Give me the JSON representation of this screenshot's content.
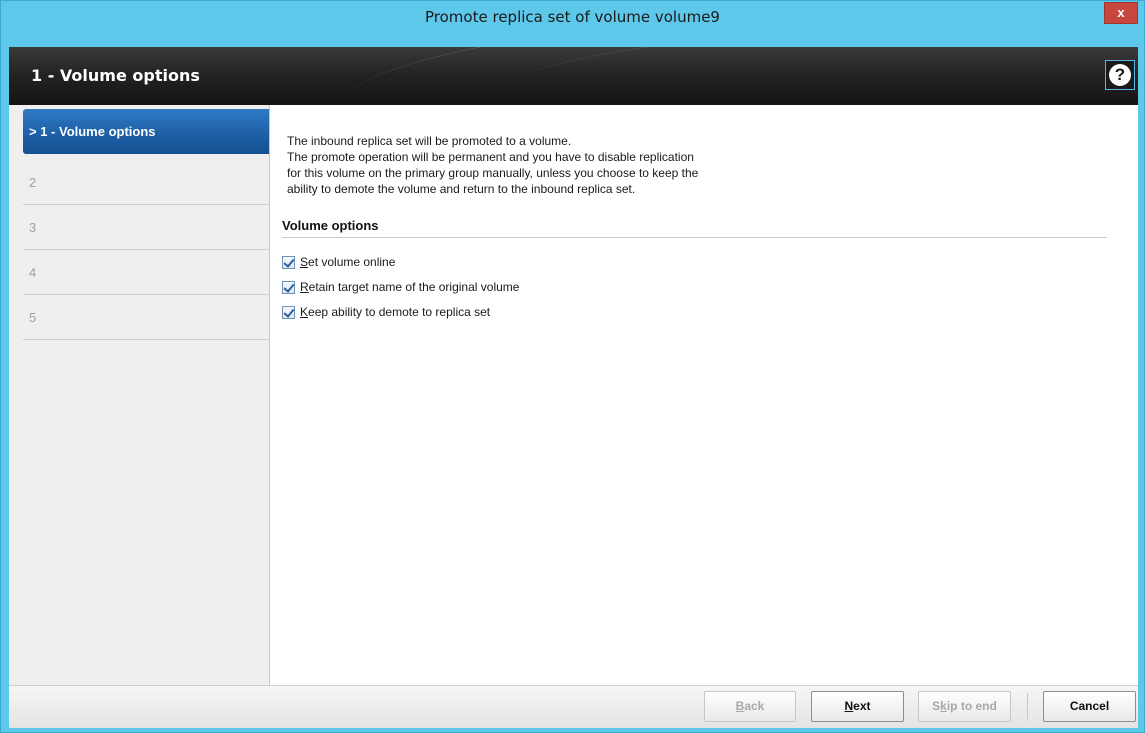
{
  "window": {
    "title": "Promote replica set of volume volume9",
    "close_label": "x"
  },
  "header": {
    "title": "1 - Volume options",
    "help_label": "?"
  },
  "sidebar": {
    "steps": [
      {
        "label": "> 1 - Volume options",
        "active": true
      },
      {
        "label": "2",
        "active": false
      },
      {
        "label": "3",
        "active": false
      },
      {
        "label": "4",
        "active": false
      },
      {
        "label": "5",
        "active": false
      }
    ]
  },
  "content": {
    "intro_lines": [
      "The inbound replica set will be promoted to a volume.",
      "The promote operation will be permanent and you have to disable replication",
      "for this volume on the primary group manually, unless you choose to keep the",
      "ability to demote the volume and return to the inbound replica set."
    ],
    "section_title": "Volume options",
    "options": [
      {
        "accel": "S",
        "rest": "et volume online",
        "checked": true
      },
      {
        "accel": "R",
        "rest": "etain target name of the original volume",
        "checked": true
      },
      {
        "accel": "K",
        "rest": "eep ability to demote to replica set",
        "checked": true
      }
    ]
  },
  "footer": {
    "back": {
      "accel": "B",
      "rest": "ack",
      "enabled": false
    },
    "next": {
      "accel": "N",
      "rest": "ext",
      "enabled": true
    },
    "skip": {
      "pre": "S",
      "accel": "k",
      "rest": "ip to end",
      "enabled": false
    },
    "cancel": {
      "label": "Cancel",
      "enabled": true
    }
  }
}
